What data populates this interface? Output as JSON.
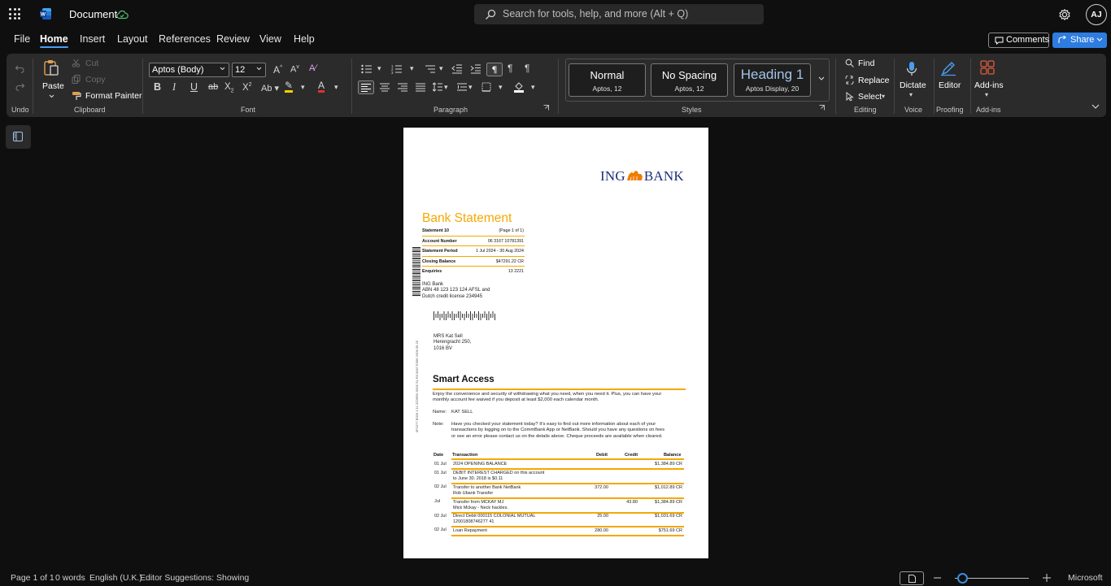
{
  "titlebar": {
    "doc_title": "Document",
    "search_placeholder": "Search for tools, help, and more (Alt + Q)",
    "avatar_initials": "AJ"
  },
  "menu": {
    "tabs": [
      "File",
      "Home",
      "Insert",
      "Layout",
      "References",
      "Review",
      "View",
      "Help"
    ],
    "active": "Home",
    "comments_label": "Comments",
    "share_label": "Share"
  },
  "ribbon": {
    "undo_group": "Undo",
    "clipboard": {
      "paste": "Paste",
      "cut": "Cut",
      "copy": "Copy",
      "format_painter": "Format Painter",
      "group": "Clipboard"
    },
    "font": {
      "family": "Aptos (Body)",
      "size": "12",
      "group": "Font"
    },
    "paragraph": {
      "group": "Paragraph"
    },
    "styles": {
      "group": "Styles",
      "items": [
        {
          "name": "Normal",
          "sub": "Aptos, 12"
        },
        {
          "name": "No Spacing",
          "sub": "Aptos, 12"
        },
        {
          "name": "Heading 1",
          "sub": "Aptos Display, 20"
        }
      ]
    },
    "editing": {
      "find": "Find",
      "replace": "Replace",
      "select": "Select",
      "group": "Editing"
    },
    "voice": {
      "dictate": "Dictate",
      "group": "Voice"
    },
    "proofing": {
      "editor": "Editor",
      "group": "Proofing"
    },
    "addins": {
      "label": "Add-ins",
      "group": "Add-ins"
    }
  },
  "document": {
    "bank_logo_left": "ING",
    "bank_logo_right": "BANK",
    "title": "Bank Statement",
    "info": [
      {
        "k": "Statement 10",
        "v": "(Page 1 of 1)"
      },
      {
        "k": "Account Number",
        "v": "06 3167 10781391"
      },
      {
        "k": "Statement Period",
        "v": "1 Jul 2024 - 30 Aug 2024"
      },
      {
        "k": "Closing Balance",
        "v": "$47291.22 CR"
      },
      {
        "k": "Enquiries",
        "v": "13 2221"
      }
    ],
    "bank_address": [
      "ING Bank",
      "ABN 48 123 123 124 AFSL and",
      "Dutch credit license 234945"
    ],
    "customer_address": [
      "MRS Kat Sell",
      "Herengracht 250,",
      "1016 BV"
    ],
    "side_code": "0F1977 R026 1 11 ZZ26R0 S005 SL R3 0097 E096 V006 05.25",
    "section_title": "Smart Access",
    "intro": [
      "Enjoy the convenience and security of withdrawing what you need, when you need it. Plus, you can have your",
      "monthly account fee waived if you deposit at least $2,000 each calendar month."
    ],
    "name_label": "Name:",
    "name_value": "KAT SELL",
    "note_label": "Note:",
    "note_lines": [
      "Have you checked your statement today? It's easy to find out more information about each of your",
      "transactions by logging on to the CommBank App or NetBank. Should you have any questions on fees",
      "or see an error please contact us on the details above. Cheque proceeds are available when cleared."
    ],
    "table_headers": {
      "date": "Date",
      "transaction": "Transaction",
      "debit": "Debit",
      "credit": "Credit",
      "balance": "Balance"
    },
    "transactions": [
      {
        "date": "01 Jul",
        "desc": [
          "2024 OPENING BALANCE"
        ],
        "debit": "",
        "credit": "",
        "balance": "$1,384.89 CR"
      },
      {
        "date": "01 Jul",
        "desc": [
          "DEBIT INTEREST CHARGED on this account",
          "to June 30. 2018 is $0.11"
        ],
        "debit": "",
        "credit": "",
        "balance": ""
      },
      {
        "date": "02 Jul",
        "desc": [
          "Transfer to another Bank NetBank",
          "Rob Ubank Transfer"
        ],
        "debit": "372.00",
        "credit": "",
        "balance": "$1,012.89 CR"
      },
      {
        "date": "Jul",
        "desc": [
          "Transfer from MCKAY MJ",
          "Mick Mckay - Neck hackles."
        ],
        "debit": "",
        "credit": "43.80",
        "balance": "$1,384.89 CR"
      },
      {
        "date": "02 Jul",
        "desc": [
          "Direct Debit 000115 COLONIAL MUTUAL",
          "12001808746277 41"
        ],
        "debit": "25.00",
        "credit": "",
        "balance": "$1,031.69 CR"
      },
      {
        "date": "02 Jul",
        "desc": [
          "Loan Repayment"
        ],
        "debit": "280.00",
        "credit": "",
        "balance": "$751.69 CR"
      }
    ]
  },
  "status": {
    "page": "Page 1 of 1",
    "words": "0 words",
    "language": "English (U.K.)",
    "editor": "Editor Suggestions: Showing",
    "provider": "Microsoft"
  },
  "colors": {
    "accent": "#2e7ce0",
    "statement_orange": "#f5a800",
    "ing_blue": "#1d2f78"
  }
}
